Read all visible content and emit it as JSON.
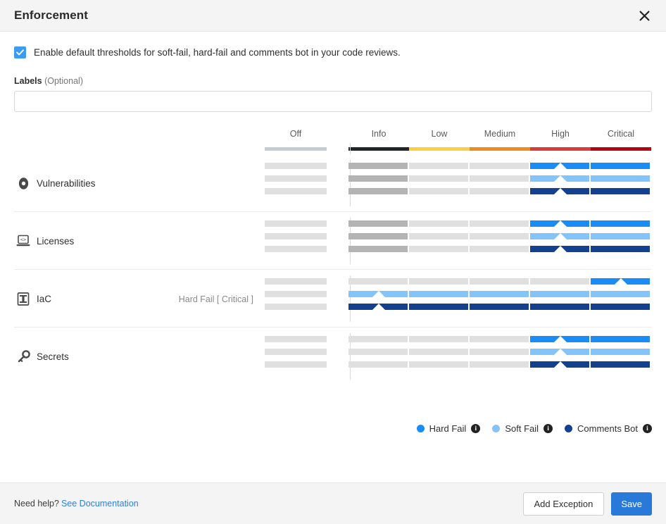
{
  "header": {
    "title": "Enforcement",
    "close_icon": "close-icon"
  },
  "options": {
    "enable_defaults": {
      "label": "Enable default thresholds for soft-fail, hard-fail and comments bot in your code reviews.",
      "checked": true
    },
    "labels_field": {
      "label": "Labels",
      "optional_suffix": "(Optional)",
      "value": "",
      "placeholder": ""
    }
  },
  "matrix": {
    "off_column": {
      "label": "Off",
      "color": "#c3ccd6"
    },
    "severity_columns": [
      {
        "label": "Info",
        "color": "#232629"
      },
      {
        "label": "Low",
        "color": "#fbcf43"
      },
      {
        "label": "Medium",
        "color": "#ef8d1c"
      },
      {
        "label": "High",
        "color": "#da3c3c"
      },
      {
        "label": "Critical",
        "color": "#b00710"
      }
    ],
    "track_colors": {
      "hard_fail": "#1a8cf5",
      "soft_fail": "#83c5fb",
      "comments_bot": "#14418f",
      "inactive": "#e0e0e0",
      "inactive_dark": "#b4b4b4",
      "off_track": "#e0e0e0"
    },
    "rows": [
      {
        "name": "Vulnerabilities",
        "icon": "vulnerability-icon",
        "tooltip": "",
        "tracks": [
          {
            "type": "hard_fail",
            "threshold": "High",
            "threshold_index": 3,
            "info_dark": true
          },
          {
            "type": "soft_fail",
            "threshold": "High",
            "threshold_index": 3,
            "info_dark": true
          },
          {
            "type": "comments_bot",
            "threshold": "High",
            "threshold_index": 3,
            "info_dark": true
          }
        ]
      },
      {
        "name": "Licenses",
        "icon": "license-code-icon",
        "tooltip": "",
        "tracks": [
          {
            "type": "hard_fail",
            "threshold": "High",
            "threshold_index": 3,
            "info_dark": true
          },
          {
            "type": "soft_fail",
            "threshold": "High",
            "threshold_index": 3,
            "info_dark": true
          },
          {
            "type": "comments_bot",
            "threshold": "High",
            "threshold_index": 3,
            "info_dark": true
          }
        ]
      },
      {
        "name": "IaC",
        "icon": "iac-icon",
        "tooltip": "Hard Fail [ Critical ]",
        "tracks": [
          {
            "type": "hard_fail",
            "threshold": "Critical",
            "threshold_index": 4,
            "info_dark": false
          },
          {
            "type": "soft_fail",
            "threshold": "Info",
            "threshold_index": 0,
            "info_dark": false
          },
          {
            "type": "comments_bot",
            "threshold": "Info",
            "threshold_index": 0,
            "info_dark": false
          }
        ]
      },
      {
        "name": "Secrets",
        "icon": "key-icon",
        "tooltip": "",
        "tracks": [
          {
            "type": "hard_fail",
            "threshold": "High",
            "threshold_index": 3,
            "info_dark": false
          },
          {
            "type": "soft_fail",
            "threshold": "High",
            "threshold_index": 3,
            "info_dark": false
          },
          {
            "type": "comments_bot",
            "threshold": "High",
            "threshold_index": 3,
            "info_dark": false
          }
        ]
      }
    ]
  },
  "legend": [
    {
      "label": "Hard Fail",
      "color": "#1a8cf5",
      "info_icon": "info-icon"
    },
    {
      "label": "Soft Fail",
      "color": "#83c5fb",
      "info_icon": "info-icon"
    },
    {
      "label": "Comments Bot",
      "color": "#14418f",
      "info_icon": "info-icon"
    }
  ],
  "footer": {
    "help_text": "Need help?",
    "help_link": "See Documentation",
    "add_exception_label": "Add Exception",
    "save_label": "Save"
  }
}
